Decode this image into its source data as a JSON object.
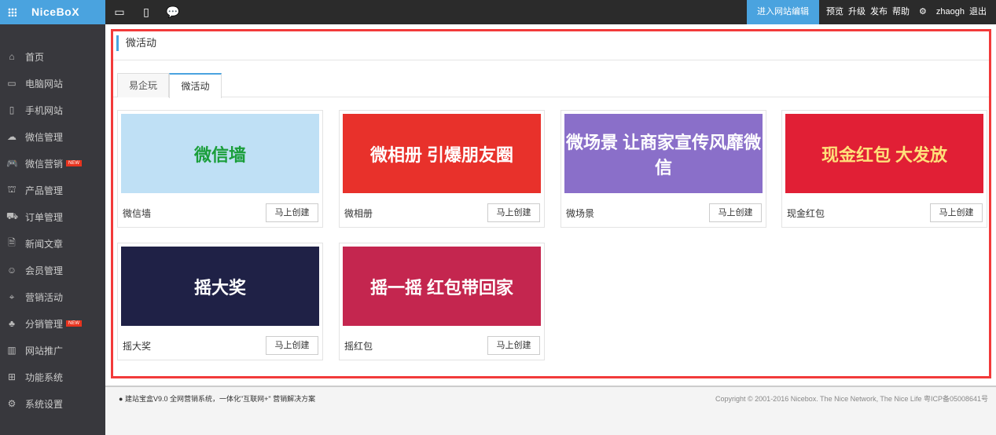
{
  "header": {
    "brand": "NiceBoX",
    "enter_edit": "进入网站编辑",
    "links": [
      "预览",
      "升级",
      "发布",
      "帮助"
    ],
    "user": "zhaogh",
    "logout": "退出"
  },
  "sidebar": {
    "new_badge": "NEW",
    "items": [
      {
        "label": "首页",
        "icon": "⌂",
        "new": false
      },
      {
        "label": "电脑网站",
        "icon": "▭",
        "new": false
      },
      {
        "label": "手机网站",
        "icon": "▯",
        "new": false
      },
      {
        "label": "微信管理",
        "icon": "☁",
        "new": false
      },
      {
        "label": "微信营销",
        "icon": "🎮",
        "new": true
      },
      {
        "label": "产品管理",
        "icon": "⛫",
        "new": false
      },
      {
        "label": "订单管理",
        "icon": "⛟",
        "new": false
      },
      {
        "label": "新闻文章",
        "icon": "🗎",
        "new": false
      },
      {
        "label": "会员管理",
        "icon": "☺",
        "new": false
      },
      {
        "label": "营销活动",
        "icon": "⌖",
        "new": false
      },
      {
        "label": "分销管理",
        "icon": "♣",
        "new": true
      },
      {
        "label": "网站推广",
        "icon": "▥",
        "new": false
      },
      {
        "label": "功能系统",
        "icon": "⊞",
        "new": false
      },
      {
        "label": "系统设置",
        "icon": "⚙",
        "new": false
      }
    ]
  },
  "main": {
    "title": "微活动",
    "tabs": [
      "易企玩",
      "微活动"
    ],
    "create_label": "马上创建",
    "cards": [
      {
        "label": "微信墙",
        "banner": "微信墙",
        "bg": "#bfe0f5",
        "fg": "#1a9e3a"
      },
      {
        "label": "微相册",
        "banner": "微相册 引爆朋友圈",
        "bg": "#e8312b",
        "fg": "#ffffff"
      },
      {
        "label": "微场景",
        "banner": "微场景 让商家宣传风靡微信",
        "bg": "#8a6fc9",
        "fg": "#ffffff"
      },
      {
        "label": "现金红包",
        "banner": "现金红包 大发放",
        "bg": "#e11f35",
        "fg": "#ffe07a"
      },
      {
        "label": "摇大奖",
        "banner": "摇大奖",
        "bg": "#1f2146",
        "fg": "#ffffff"
      },
      {
        "label": "摇红包",
        "banner": "摇一摇 红包带回家",
        "bg": "#c4264f",
        "fg": "#ffffff"
      }
    ]
  },
  "footer": {
    "left": "建站宝盒V9.0 全网营销系统，一体化\"互联网+\" 营销解决方案",
    "right": "Copyright © 2001-2016 Nicebox. The Nice Network, The Nice Life 粤ICP备05008641号"
  }
}
